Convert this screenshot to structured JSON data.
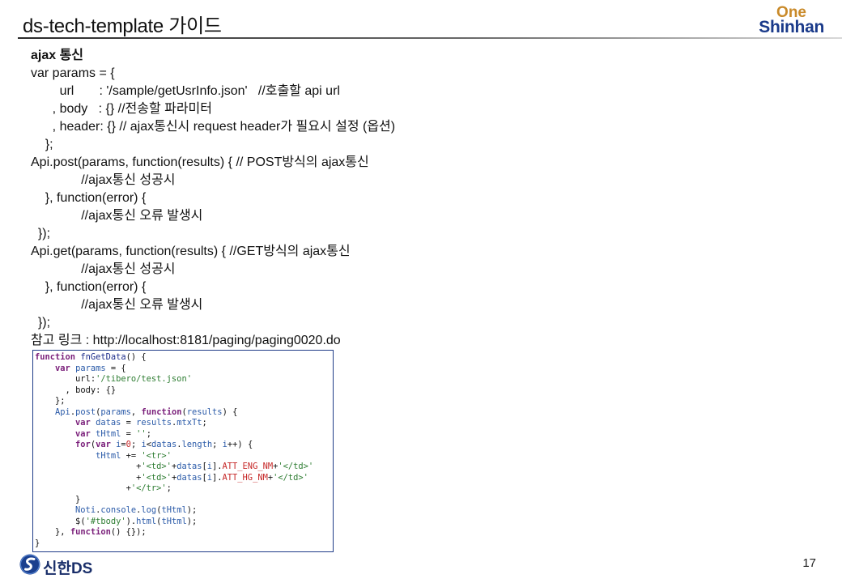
{
  "header": {
    "title": "ds-tech-template 가이드",
    "brand_top": "One",
    "brand_name": "Shinhan"
  },
  "content": {
    "lines": [
      "ajax 통신",
      "var params = {",
      "        url       : '/sample/getUsrInfo.json'   //호출할 api url",
      "      , body   : {} //전송할 파라미터",
      "      , header: {} // ajax통신시 request header가 필요시 설정 (옵션)",
      "    };",
      "Api.post(params, function(results) { // POST방식의 ajax통신",
      "              //ajax통신 성공시",
      "    }, function(error) {",
      "              //ajax통신 오류 발생시",
      "  });",
      "Api.get(params, function(results) { //GET방식의 ajax통신",
      "              //ajax통신 성공시",
      "    }, function(error) {",
      "              //ajax통신 오류 발생시",
      "  });",
      "참고 링크 : http://localhost:8181/paging/paging0020.do"
    ]
  },
  "code": {
    "lines": [
      "function fnGetData() {",
      "    var params = {",
      "        url:'/tibero/test.json'",
      "      , body: {}",
      "    };",
      "    Api.post(params, function(results) {",
      "        var datas = results.mtxTt;",
      "        var tHtml = '';",
      "        for(var i=0; i<datas.length; i++) {",
      "            tHtml += '<tr>'",
      "                    +'<td>'+datas[i].ATT_ENG_NM+'</td>'",
      "                    +'<td>'+datas[i].ATT_HG_NM+'</td>'",
      "                  +'</tr>';",
      "        }",
      "        Noti.console.log(tHtml);",
      "        $('#tbody').html(tHtml);",
      "    }, function() {});",
      "}"
    ]
  },
  "footer": {
    "logo_text": "신한DS",
    "page_number": "17"
  },
  "colors": {
    "brand_blue": "#1a3a8a",
    "brand_gold": "#c98a2a",
    "code_border": "#1f3c88"
  }
}
